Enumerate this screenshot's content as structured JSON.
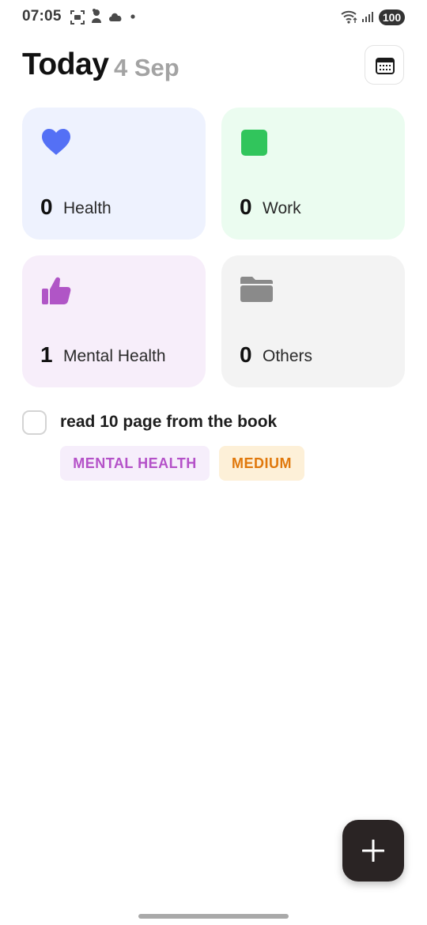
{
  "status_bar": {
    "time": "07:05",
    "battery": "100",
    "icons": [
      "screenshot-icon",
      "notification-icon",
      "cloud-icon",
      "dot-icon",
      "wifi-icon",
      "signal-icon"
    ]
  },
  "header": {
    "title": "Today",
    "date": "4 Sep",
    "calendar_icon": "calendar-icon"
  },
  "categories": [
    {
      "count": "0",
      "label": "Health",
      "icon": "heart-icon",
      "bg": "#eef2fe",
      "icon_color": "#5470f5"
    },
    {
      "count": "0",
      "label": "Work",
      "icon": "square-icon",
      "bg": "#ebfcf0",
      "icon_color": "#31c55c"
    },
    {
      "count": "1",
      "label": "Mental Health",
      "icon": "thumbs-up-icon",
      "bg": "#f7eefa",
      "icon_color": "#b055c6"
    },
    {
      "count": "0",
      "label": "Others",
      "icon": "folder-icon",
      "bg": "#f3f3f3",
      "icon_color": "#8a8a8a"
    }
  ],
  "tasks": [
    {
      "title": "read 10 page from the book",
      "category_tag": "MENTAL HEALTH",
      "priority_tag": "MEDIUM",
      "checked": false
    }
  ],
  "fab": {
    "icon": "plus-icon"
  }
}
